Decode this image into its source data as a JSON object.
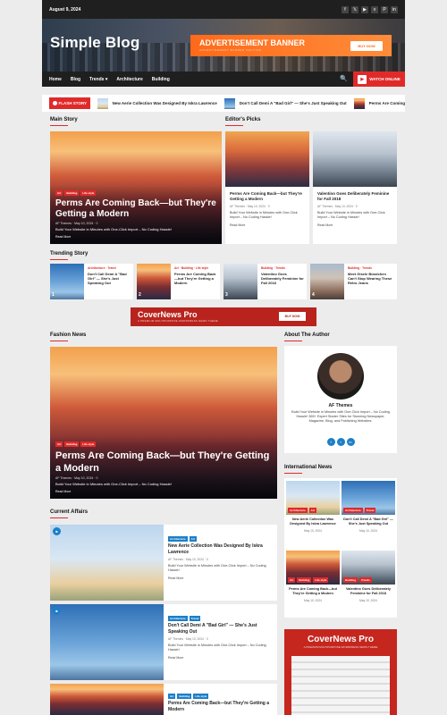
{
  "topbar": {
    "date": "August 9, 2024",
    "social_icons": [
      "facebook-icon",
      "x-icon",
      "youtube-icon",
      "vimeo-icon",
      "pinterest-icon",
      "linkedin-icon"
    ],
    "social_glyphs": [
      "f",
      "𝕏",
      "▶",
      "v",
      "P",
      "in"
    ]
  },
  "header": {
    "site_title": "Simple Blog",
    "ad_title": "ADVERTISEMENT BANNER",
    "ad_subtitle": "ADVERTISEMENT BANNER SECTION",
    "ad_button": "BUY NOW"
  },
  "nav": {
    "items": [
      "Home",
      "Blog",
      "Trends",
      "Architecture",
      "Building"
    ],
    "trends_caret": "▾",
    "watch_label": "WATCH ONLINE",
    "search_glyph": "🔍",
    "play_glyph": "▶"
  },
  "ticker": {
    "label": "FLASH STORY",
    "items": [
      "New Aerie Collection Was Designed By Iskra Lawrence",
      "Don't Call Demi A \"Bad Girl\" — She's Just Speaking Out",
      "Perms Are Coming"
    ]
  },
  "main_story": {
    "section": "Main Story",
    "tags": [
      "Art",
      "Building",
      "Life style"
    ],
    "headline": "Perms Are Coming Back—but They're Getting a Modern",
    "meta": "AF Themes  ·  May 10, 2024  ·  0",
    "excerpt": "Build Your Website in Minutes with One-Click Import – No Coding Hassle!",
    "read_more": "Read More"
  },
  "editors_picks": {
    "section": "Editor's Picks",
    "cards": [
      {
        "title": "Perms Are Coming Back—but They're Getting a Modern",
        "meta": "AF Themes  ·  May 10, 2024  ·  0",
        "excerpt": "Build Your Website in Minutes with One-Click Import – No Coding Hassle!",
        "read_more": "Read More"
      },
      {
        "title": "Valentino Goes Deliberately Feminine for Fall 2018",
        "meta": "AF Themes  ·  May 10, 2024  ·  0",
        "excerpt": "Build Your Website in Minutes with One-Click Import – No Coding Hassle!",
        "read_more": "Read More"
      }
    ]
  },
  "trending": {
    "section": "Trending Story",
    "items": [
      {
        "cats": "Architecture  ·  Travel",
        "title": "Don't Call Demi A \"Bad Girl\" — She's Just Speaking Out",
        "num": "1"
      },
      {
        "cats": "Art  ·  Building  ·  Life style",
        "title": "Perms Are Coming Back—but They're Getting a Modern",
        "num": "2"
      },
      {
        "cats": "Building  ·  Trends",
        "title": "Valentino Goes Deliberately Feminine for Fall 2018",
        "num": "3"
      },
      {
        "cats": "Building  ·  Trends",
        "title": "Meet Gisele Bündchen Can't Stop Wearing These Retro Jeans",
        "num": "4"
      }
    ]
  },
  "mid_banner": {
    "title": "CoverNews Pro",
    "subtitle": "A PREMIUM MULTIPURPOSE WORDPRESS NEWS THEME",
    "button": "BUY NOW"
  },
  "fashion": {
    "section": "Fashion News",
    "tags": [
      "Art",
      "Building",
      "Life style"
    ],
    "headline": "Perms Are Coming Back—but They're Getting a Modern",
    "meta": "AF Themes  ·  May 10, 2024  ·  0",
    "excerpt": "Build Your Website in Minutes with One-Click Import – No Coding Hassle!",
    "read_more": "Read More"
  },
  "current_affairs": {
    "section": "Current Affairs",
    "items": [
      {
        "tags": [
          "Architecture",
          "Art"
        ],
        "title": "New Aerie Collection Was Designed By Iskra Lawrence",
        "meta": "AF Themes  ·  May 10, 2024  ·  0",
        "excerpt": "Build Your Website in Minutes with One-Click Import – No Coding Hassle!",
        "read_more": "Read More"
      },
      {
        "tags": [
          "Architecture",
          "Travel"
        ],
        "title": "Don't Call Demi A \"Bad Girl\" — She's Just Speaking Out",
        "meta": "AF Themes  ·  May 10, 2024  ·  0",
        "excerpt": "Build Your Website in Minutes with One-Click Import – No Coding Hassle!",
        "read_more": "Read More"
      },
      {
        "tags": [
          "Art",
          "Building",
          "Life style"
        ],
        "title": "Perms Are Coming Back—but They're Getting a Modern",
        "meta": "",
        "excerpt": "",
        "read_more": ""
      }
    ]
  },
  "about": {
    "section": "About The Author",
    "name": "AF Themes",
    "bio": "Build Your Website in Minutes with One-Click Import – No Coding Hassle! 365+ Expert Starter Sites for Stunning Newspaper, Magazine, Blog, and Publishing Websites.",
    "social": [
      "f",
      "t",
      "in"
    ]
  },
  "international": {
    "section": "International News",
    "items": [
      {
        "tags": [
          "Architecture",
          "Art"
        ],
        "title": "New Aerie Collection Was Designed By Iskra Lawrence",
        "meta": "May 10, 2024"
      },
      {
        "tags": [
          "Architecture",
          "Travel"
        ],
        "title": "Don't Call Demi A \"Bad Girl\" — She's Just Speaking Out",
        "meta": "May 10, 2024"
      },
      {
        "tags": [
          "Art",
          "Building",
          "Life style"
        ],
        "title": "Perms Are Coming Back—but They're Getting a Modern",
        "meta": "May 10, 2024"
      },
      {
        "tags": [
          "Building",
          "Trends"
        ],
        "title": "Valentino Goes Deliberately Feminine for Fall 2018",
        "meta": "May 10, 2024"
      }
    ]
  },
  "side_ad": {
    "title": "CoverNews Pro",
    "subtitle": "A PREMIUM MULTIPURPOSE WORDPRESS NEWS THEME"
  },
  "colors": {
    "accent": "#e02a2a",
    "dark": "#1f1f1f",
    "orange": "#ff6a1a",
    "blue": "#1c7fc8"
  }
}
